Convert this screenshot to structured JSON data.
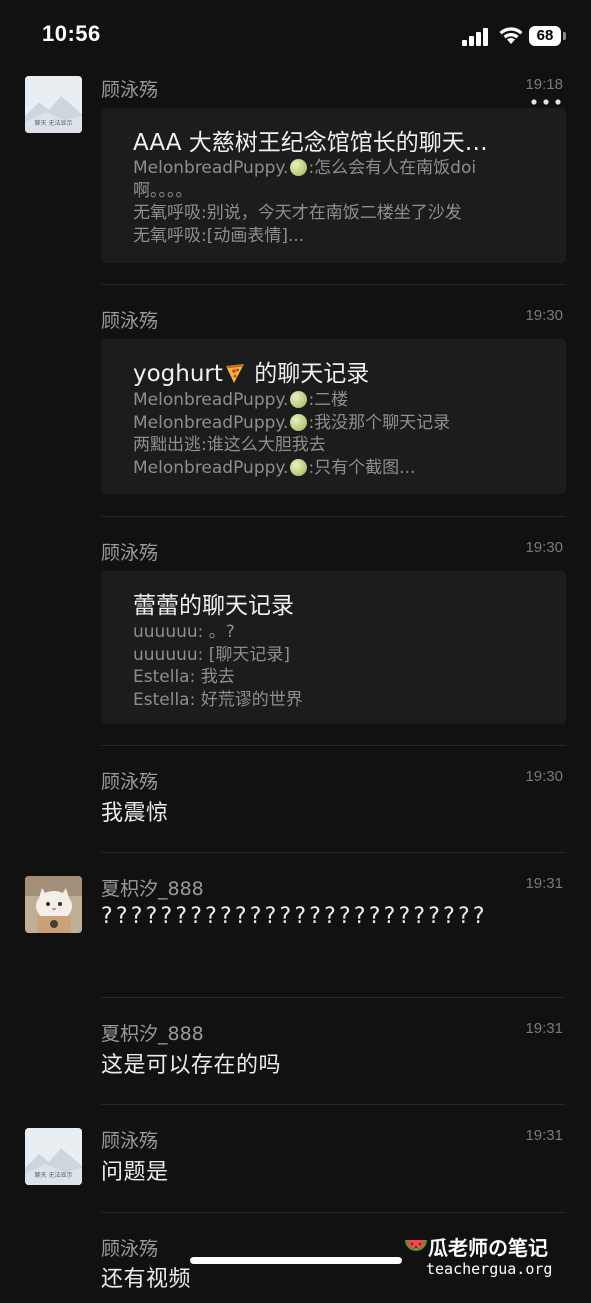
{
  "status_bar": {
    "time": "10:56",
    "battery": "68"
  },
  "messages": [
    {
      "sender": "顾泳殇",
      "time": "19:18",
      "type": "card",
      "card_title": "AAA 大慈树王纪念馆馆长的聊天…",
      "lines": [
        "MelonbreadPuppy.🍈:怎么会有人在南饭doi",
        "啊。。。。",
        "无氧呼吸:别说，今天才在南饭二楼坐了沙发",
        "无氧呼吸:[动画表情]..."
      ]
    },
    {
      "sender": "顾泳殇",
      "time": "19:30",
      "type": "card",
      "card_title": "yoghurt🍕 的聊天记录",
      "lines": [
        "MelonbreadPuppy.🍈:二楼",
        "MelonbreadPuppy.🍈:我没那个聊天记录",
        "两黜出逃:谁这么大胆我去",
        "MelonbreadPuppy.🍈:只有个截图..."
      ]
    },
    {
      "sender": "顾泳殇",
      "time": "19:30",
      "type": "card",
      "card_title": "蕾蕾的聊天记录",
      "lines": [
        "uuuuuu: 。?",
        "uuuuuu: [聊天记录]",
        "Estella: 我去",
        "Estella: 好荒谬的世界"
      ]
    },
    {
      "sender": "顾泳殇",
      "time": "19:30",
      "type": "text",
      "text": "我震惊"
    },
    {
      "sender": "夏枳汐_888",
      "time": "19:31",
      "type": "text",
      "text": "??????????????????????????"
    },
    {
      "sender": "夏枳汐_888",
      "time": "19:31",
      "type": "text",
      "text": "这是可以存在的吗"
    },
    {
      "sender": "顾泳殇",
      "time": "19:31",
      "type": "text",
      "text": "问题是"
    },
    {
      "sender": "顾泳殇",
      "time": "",
      "type": "text",
      "text": "还有视频"
    }
  ],
  "avatar_caption": "聊天 无法显示",
  "watermark": {
    "title": "瓜老师の笔记",
    "url": "teachergua.org",
    "icon": "watermelon-icon"
  },
  "colors": {
    "background": "#111111",
    "card": "#1c1c1c",
    "text": "#ececec",
    "muted": "#9a9a9a"
  }
}
